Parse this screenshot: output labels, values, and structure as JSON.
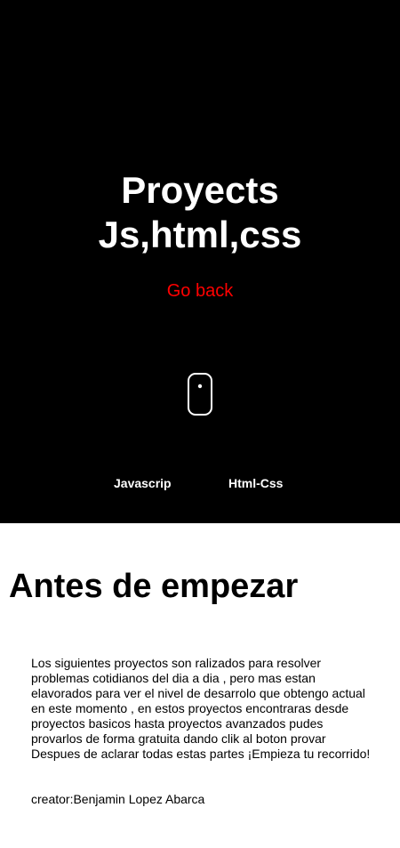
{
  "hero": {
    "title_line1": "Proyects",
    "title_line2": "Js,html,css",
    "go_back": "Go back",
    "scroll_icon": "mouse-scroll-icon",
    "nav": {
      "javascript": "Javascrip",
      "html_css": "Html-Css"
    }
  },
  "about": {
    "title": "Antes de empezar",
    "text": "Los siguientes proyectos son ralizados para resolver problemas cotidianos del dia a dia , pero mas estan elavorados para ver el nivel de desarrolo que obtengo actual en este momento , en estos proyectos encontraras desde proyectos basicos hasta proyectos avanzados pudes provarlos de forma gratuita dando clik al boton provar Despues de aclarar todas estas partes ¡Empieza tu recorrido!",
    "creator": "creator:Benjamin Lopez Abarca"
  },
  "colors": {
    "hero_background": "#000000",
    "link_accent": "#ff0000",
    "text_light": "#ffffff",
    "text_dark": "#000000"
  }
}
